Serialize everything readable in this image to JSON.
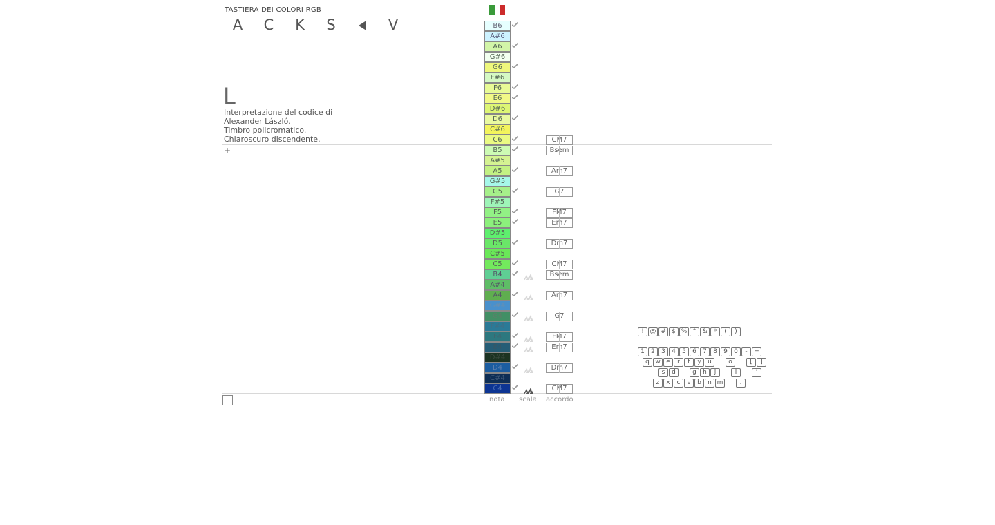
{
  "header": {
    "title": "TASTIERA DEI COLORI RGB",
    "menu": [
      "A",
      "C",
      "K",
      "S",
      "V"
    ],
    "flag_colors": [
      "#3a9a3a",
      "#ffffff",
      "#cc2b2b"
    ]
  },
  "info": {
    "big_letter": "L",
    "lines": [
      "Interpretazione del codice di",
      "Alexander László.",
      "Timbro policromatico.",
      "Chiaroscuro discendente."
    ],
    "plus": "+"
  },
  "notes": [
    {
      "label": "B6",
      "color": "#e6ffff",
      "text": "#667"
    },
    {
      "label": "A#6",
      "color": "#cdf2ff",
      "text": "#557"
    },
    {
      "label": "A6",
      "color": "#d2f5a8",
      "text": "#565"
    },
    {
      "label": "G#6",
      "color": "#f2fff0",
      "text": "#565"
    },
    {
      "label": "G6",
      "color": "#eef77c",
      "text": "#565"
    },
    {
      "label": "F#6",
      "color": "#d5f9c4",
      "text": "#565"
    },
    {
      "label": "F6",
      "color": "#e8fb96",
      "text": "#565"
    },
    {
      "label": "E6",
      "color": "#f1f987",
      "text": "#565"
    },
    {
      "label": "D#6",
      "color": "#ddf574",
      "text": "#565"
    },
    {
      "label": "D6",
      "color": "#e9f9a0",
      "text": "#565"
    },
    {
      "label": "C#6",
      "color": "#f3f45c",
      "text": "#565"
    },
    {
      "label": "C6",
      "color": "#eafa83",
      "text": "#565"
    },
    {
      "label": "B5",
      "color": "#cdfbb4",
      "text": "#565"
    },
    {
      "label": "A#5",
      "color": "#d5f392",
      "text": "#565"
    },
    {
      "label": "A5",
      "color": "#c3f184",
      "text": "#565"
    },
    {
      "label": "G#5",
      "color": "#a6f8e9",
      "text": "#565"
    },
    {
      "label": "G5",
      "color": "#a6f08a",
      "text": "#565"
    },
    {
      "label": "F#5",
      "color": "#9ef5b8",
      "text": "#565"
    },
    {
      "label": "F5",
      "color": "#92f185",
      "text": "#565"
    },
    {
      "label": "E5",
      "color": "#8cf07c",
      "text": "#565"
    },
    {
      "label": "D#5",
      "color": "#5ef06e",
      "text": "#565"
    },
    {
      "label": "D5",
      "color": "#6ae768",
      "text": "#565"
    },
    {
      "label": "C#5",
      "color": "#6ae858",
      "text": "#565"
    },
    {
      "label": "C5",
      "color": "#73ea5d",
      "text": "#565"
    },
    {
      "label": "B4",
      "color": "#5fcf94",
      "text": "#556"
    },
    {
      "label": "A#4",
      "color": "#5ebd66",
      "text": "#556"
    },
    {
      "label": "A4",
      "color": "#5fae4f",
      "text": "#556"
    },
    {
      "label": "G#4",
      "color": "#4990cc",
      "text": "#6a8fb0"
    },
    {
      "label": "G4",
      "color": "#428f65",
      "text": "#5d7f6a"
    },
    {
      "label": "F#4",
      "color": "#2b7a97",
      "text": "#3f6f85"
    },
    {
      "label": "F4",
      "color": "#2d787f",
      "text": "#3f6670"
    },
    {
      "label": "E4",
      "color": "#265d76",
      "text": "#375766"
    },
    {
      "label": "D#4",
      "color": "#1c3322",
      "text": "#3a4a3f"
    },
    {
      "label": "D4",
      "color": "#1c5da0",
      "text": "#5b7fae"
    },
    {
      "label": "C#4",
      "color": "#0e2e55",
      "text": "#3d5777"
    },
    {
      "label": "C4",
      "color": "#0d3593",
      "text": "#4a6db4"
    }
  ],
  "ticks": [
    "B6",
    "A6",
    "G6",
    "F6",
    "E6",
    "D6",
    "C6",
    "B5",
    "A5",
    "G5",
    "F5",
    "E5",
    "D5",
    "C5",
    "B4",
    "A4",
    "G4",
    "F4",
    "E4",
    "D4",
    "C4"
  ],
  "scale_rows": [
    "B4",
    "A4",
    "G4",
    "F4",
    "E4",
    "D4",
    "C4"
  ],
  "chords": [
    {
      "label": "CM7",
      "row": "C6"
    },
    {
      "label": "Bsem",
      "row": "B5"
    },
    {
      "label": "Am7",
      "row": "A5"
    },
    {
      "label": "G7",
      "row": "G5"
    },
    {
      "label": "FM7",
      "row": "F5"
    },
    {
      "label": "Em7",
      "row": "E5"
    },
    {
      "label": "Dm7",
      "row": "D5"
    },
    {
      "label": "CM7",
      "row": "C5"
    },
    {
      "label": "Bsem",
      "row": "B4"
    },
    {
      "label": "Am7",
      "row": "A4"
    },
    {
      "label": "G7",
      "row": "G4"
    },
    {
      "label": "FM7",
      "row": "F4"
    },
    {
      "label": "Em7",
      "row": "E4"
    },
    {
      "label": "Dm7",
      "row": "D4"
    },
    {
      "label": "CM7",
      "row": "C4"
    }
  ],
  "columns": {
    "nota": "nota",
    "scala": "scala",
    "accordo": "accordo"
  },
  "keyboard": {
    "row0": [
      "!",
      "@",
      "#",
      "$",
      "%",
      "^",
      "&",
      "*",
      "(",
      ")"
    ],
    "row1": [
      "1",
      "2",
      "3",
      "4",
      "5",
      "6",
      "7",
      "8",
      "9",
      "0",
      "-",
      "="
    ],
    "row2": [
      "q",
      "w",
      "e",
      "r",
      "t",
      "y",
      "u",
      "o",
      "[",
      "]"
    ],
    "row3": [
      "s",
      "d",
      "g",
      "h",
      "j",
      "l",
      "'"
    ],
    "row4": [
      "z",
      "x",
      "c",
      "v",
      "b",
      "n",
      "m",
      "."
    ]
  }
}
